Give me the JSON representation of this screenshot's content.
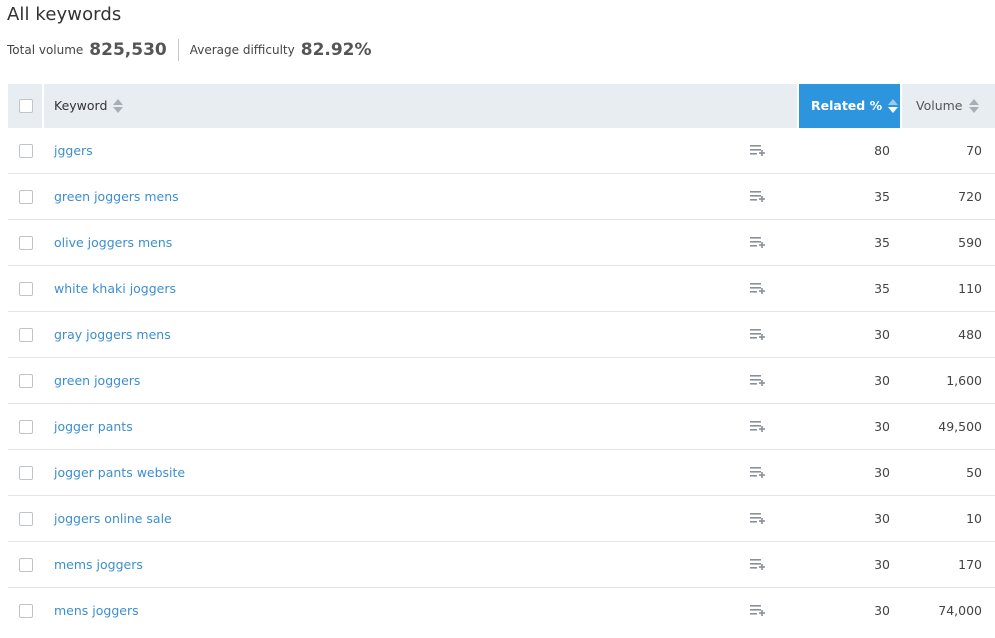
{
  "header": {
    "title": "All keywords",
    "total_volume_label": "Total volume",
    "total_volume_value": "825,530",
    "avg_difficulty_label": "Average difficulty",
    "avg_difficulty_value": "82.92%"
  },
  "table": {
    "columns": {
      "keyword": "Keyword",
      "related": "Related %",
      "volume": "Volume"
    },
    "active_sort_color": "#2d95dd",
    "link_color": "#3b8fd0",
    "rows": [
      {
        "keyword": "jggers",
        "related": "80",
        "volume": "70",
        "action_icon": "add-to-list-icon"
      },
      {
        "keyword": "green joggers mens",
        "related": "35",
        "volume": "720",
        "action_icon": "add-to-list-icon"
      },
      {
        "keyword": "olive joggers mens",
        "related": "35",
        "volume": "590",
        "action_icon": "add-to-list-icon"
      },
      {
        "keyword": "white khaki joggers",
        "related": "35",
        "volume": "110",
        "action_icon": "add-to-list-icon"
      },
      {
        "keyword": "gray joggers mens",
        "related": "30",
        "volume": "480",
        "action_icon": "add-to-list-icon"
      },
      {
        "keyword": "green joggers",
        "related": "30",
        "volume": "1,600",
        "action_icon": "add-to-list-icon"
      },
      {
        "keyword": "jogger pants",
        "related": "30",
        "volume": "49,500",
        "action_icon": "add-to-list-icon"
      },
      {
        "keyword": "jogger pants website",
        "related": "30",
        "volume": "50",
        "action_icon": "add-to-list-icon"
      },
      {
        "keyword": "joggers online sale",
        "related": "30",
        "volume": "10",
        "action_icon": "add-to-list-icon"
      },
      {
        "keyword": "mems joggers",
        "related": "30",
        "volume": "170",
        "action_icon": "add-to-list-icon"
      },
      {
        "keyword": "mens joggers",
        "related": "30",
        "volume": "74,000",
        "action_icon": "add-to-list-icon"
      }
    ]
  }
}
